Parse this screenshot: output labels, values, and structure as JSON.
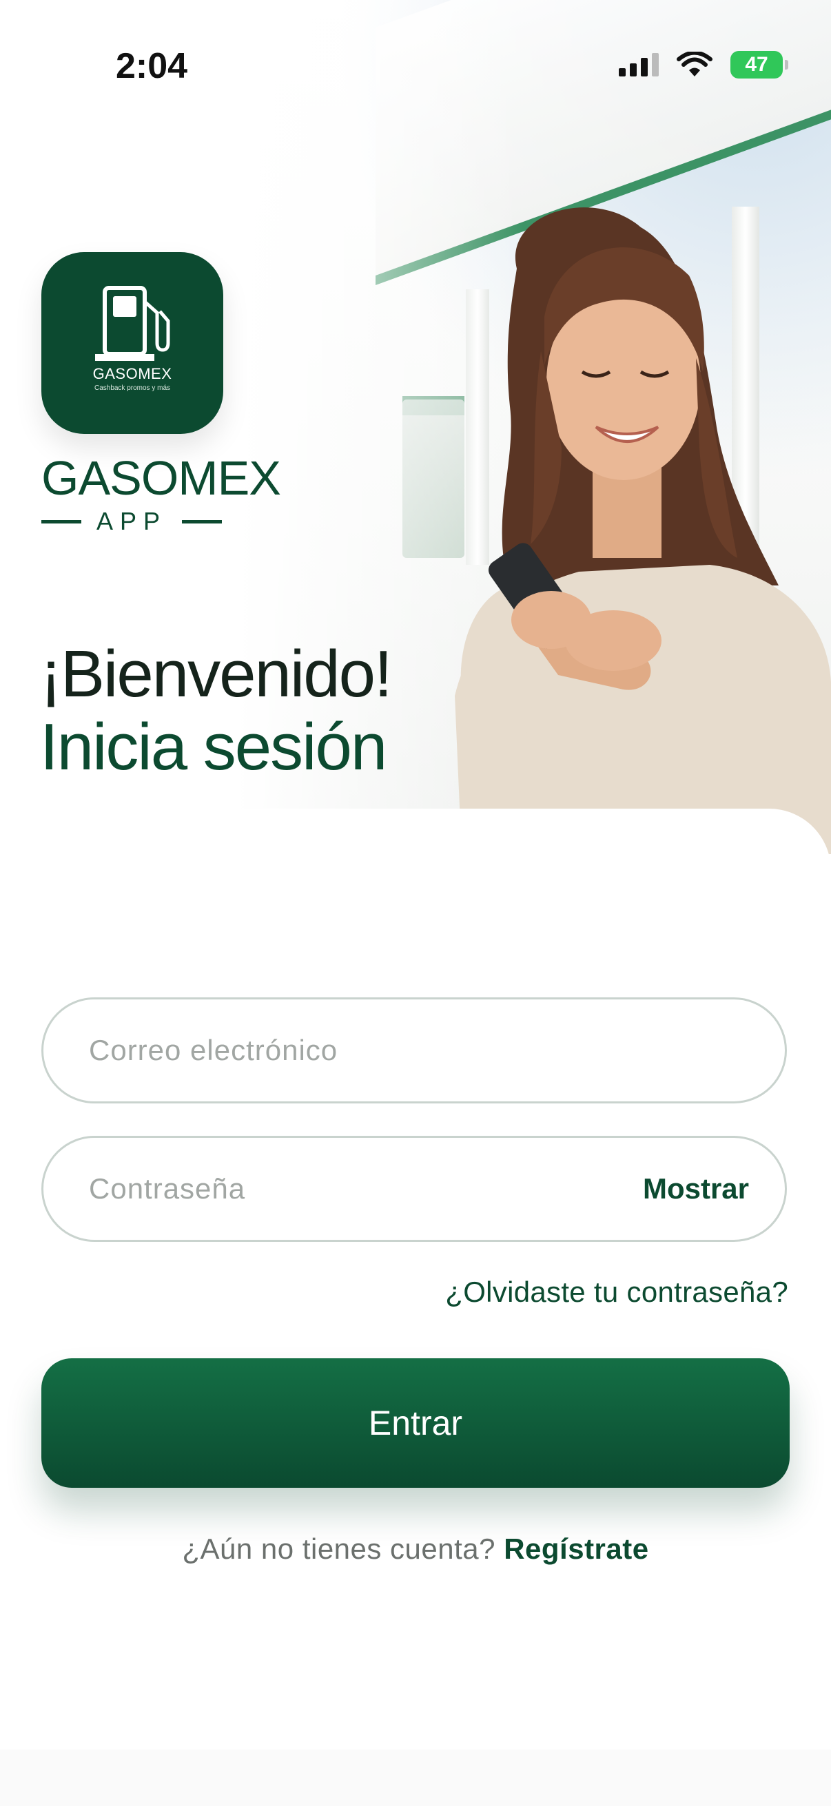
{
  "status_bar": {
    "time": "2:04",
    "battery": "47"
  },
  "brand": {
    "icon_name": "GASOMEX",
    "icon_tagline": "Cashback promos y más",
    "name": "GASOMEX",
    "sub": "APP",
    "color": "#0c4a30"
  },
  "headline": {
    "welcome": "¡Bienvenido!",
    "subtitle": "Inicia sesión"
  },
  "form": {
    "email_placeholder": "Correo electrónico",
    "email_value": "",
    "password_placeholder": "Contraseña",
    "password_value": "",
    "show_label": "Mostrar",
    "forgot_label": "¿Olvidaste tu contraseña?",
    "submit_label": "Entrar"
  },
  "footer": {
    "question": "¿Aún no tienes cuenta?",
    "register_label": "Regístrate"
  },
  "icons": [
    "signal-icon",
    "wifi-icon",
    "battery-icon",
    "fuel-pump-icon"
  ]
}
